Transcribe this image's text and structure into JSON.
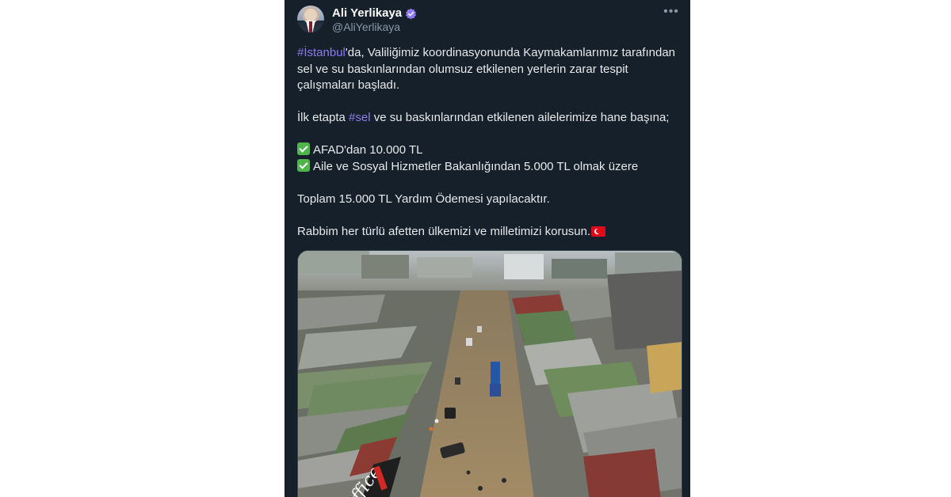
{
  "tweet": {
    "author": {
      "display_name": "Ali Yerlikaya",
      "handle": "@AliYerlikaya",
      "verified": true
    },
    "text": {
      "p1_hashtag": "#İstanbul",
      "p1_rest": "'da, Valiliğimiz koordinasyonunda Kaymakamlarımız tarafından sel ve su baskınlarından olumsuz etkilenen yerlerin zarar tespit çalışmaları başladı.",
      "p2_prefix": " İlk etapta ",
      "p2_hashtag": "#sel",
      "p2_rest": " ve su baskınlarından etkilenen ailelerimize hane başına;",
      "item1": "AFAD'dan 10.000 TL",
      "item2": "Aile ve Sosyal Hizmetler Bakanlığından 5.000 TL olmak üzere",
      "total": "Toplam 15.000 TL Yardım Ödemesi yapılacaktır.",
      "closing": "Rabbim her türlü afetten ülkemizi ve milletimizi korusun."
    },
    "icons": {
      "more": "more-options-icon",
      "verified": "verified-badge-icon",
      "check": "check-mark-icon",
      "flag": "turkey-flag-icon"
    },
    "media": {
      "kind": "aerial-photo"
    }
  },
  "colors": {
    "background": "#15202b",
    "text": "#e7e9ea",
    "secondary_text": "#8b98a5",
    "hashtag": "#8c7cf0",
    "verified": "#8c7cf0"
  }
}
